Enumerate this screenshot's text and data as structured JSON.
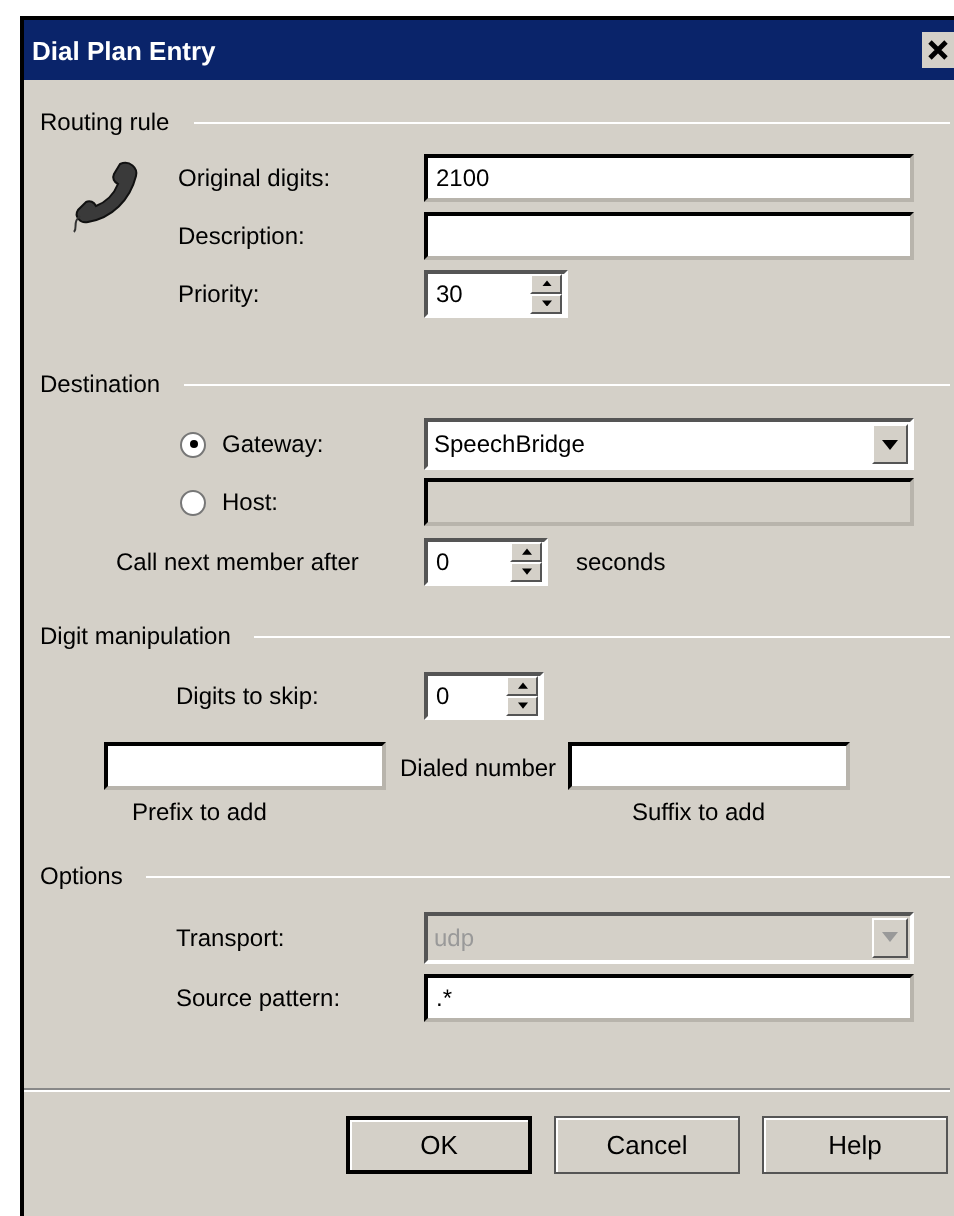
{
  "window": {
    "title": "Dial Plan Entry"
  },
  "routing_rule": {
    "heading": "Routing rule",
    "original_digits": {
      "label": "Original digits:",
      "value": "2100"
    },
    "description": {
      "label": "Description:"
    },
    "priority": {
      "label": "Priority:",
      "value": "30"
    }
  },
  "destination": {
    "heading": "Destination",
    "targets": [
      {
        "label": "Gateway:",
        "selected": true,
        "kind": "dropdown",
        "value": "SpeechBridge"
      },
      {
        "label": "Host:",
        "selected": false,
        "kind": "text"
      }
    ],
    "call_next": {
      "label": "Call next member after",
      "value": "0",
      "unit": "seconds"
    }
  },
  "digit_manipulation": {
    "heading": "Digit manipulation",
    "digits_to_skip": {
      "label": "Digits to skip:",
      "value": "0"
    },
    "prefix_caption": "Prefix to add",
    "dialed_number": "Dialed number",
    "suffix_caption": "Suffix to add"
  },
  "options": {
    "heading": "Options",
    "transport": {
      "label": "Transport:",
      "value": "udp",
      "disabled": true
    },
    "source_pattern": {
      "label": "Source pattern:",
      "value": ".*"
    }
  },
  "buttons": [
    {
      "label": "OK",
      "default": true
    },
    {
      "label": "Cancel",
      "default": false
    },
    {
      "label": "Help",
      "default": false
    }
  ]
}
